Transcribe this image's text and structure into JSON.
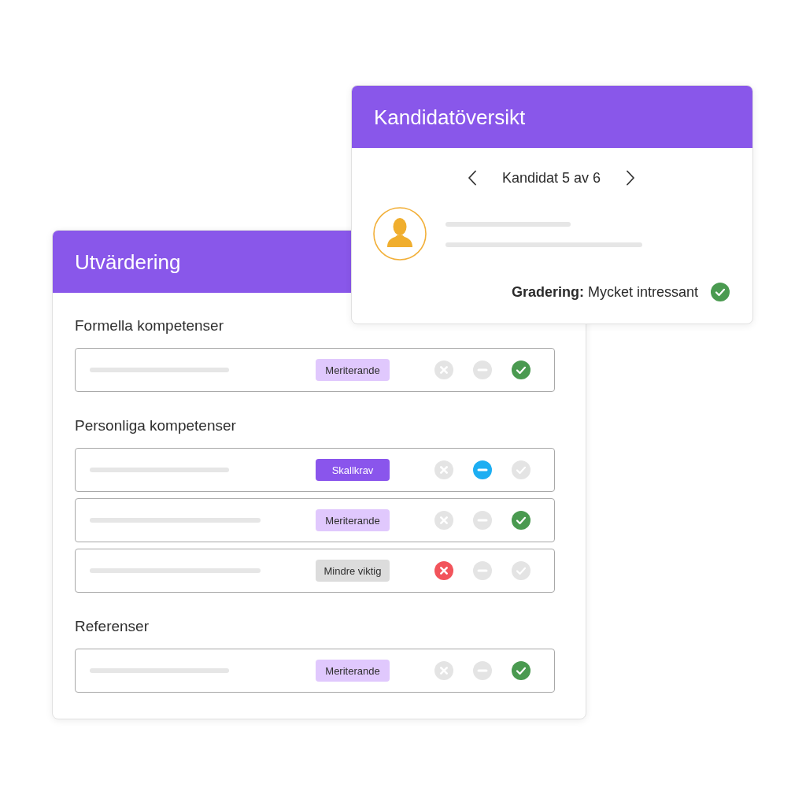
{
  "candidate_overview": {
    "title": "Kandidatöversikt",
    "navigation": {
      "label": "Kandidat 5 av 6"
    },
    "grading": {
      "text": "**Gradering:** Mycket intressant",
      "kind": "accept"
    }
  },
  "evaluation": {
    "title": "Utvärdering",
    "sections": [
      {
        "heading": "Formella kompetenser",
        "rows": [
          {
            "kind": "short",
            "tag": {
              "label": "Meriterande",
              "kind": "merit"
            },
            "choices": [
              {
                "kind": "reject",
                "selected": false
              },
              {
                "kind": "neutral",
                "selected": false
              },
              {
                "kind": "accept",
                "selected": true
              }
            ]
          }
        ]
      },
      {
        "heading": "Personliga kompetenser",
        "rows": [
          {
            "kind": "short",
            "tag": {
              "label": "Skallkrav",
              "kind": "must"
            },
            "choices": [
              {
                "kind": "reject",
                "selected": false
              },
              {
                "kind": "neutral",
                "selected": true
              },
              {
                "kind": "accept",
                "selected": false
              }
            ]
          },
          {
            "kind": "long",
            "tag": {
              "label": "Meriterande",
              "kind": "merit"
            },
            "choices": [
              {
                "kind": "reject",
                "selected": false
              },
              {
                "kind": "neutral",
                "selected": false
              },
              {
                "kind": "accept",
                "selected": true
              }
            ]
          },
          {
            "kind": "long",
            "tag": {
              "label": "Mindre viktig",
              "kind": "minor"
            },
            "choices": [
              {
                "kind": "reject",
                "selected": true
              },
              {
                "kind": "neutral",
                "selected": false
              },
              {
                "kind": "accept",
                "selected": false
              }
            ]
          }
        ]
      },
      {
        "heading": "Referenser",
        "rows": [
          {
            "kind": "short",
            "tag": {
              "label": "Meriterande",
              "kind": "merit"
            },
            "choices": [
              {
                "kind": "reject",
                "selected": false
              },
              {
                "kind": "neutral",
                "selected": false
              },
              {
                "kind": "accept",
                "selected": true
              }
            ]
          }
        ]
      }
    ]
  }
}
